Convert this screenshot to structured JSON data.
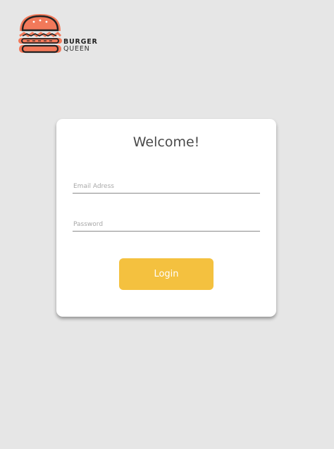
{
  "brand": {
    "line1": "BURGER",
    "line2": "QUEEN",
    "logo_icon": "burger-icon",
    "accent_color": "#f2795a"
  },
  "login": {
    "title": "Welcome!",
    "email_placeholder": "Email Adress",
    "password_placeholder": "Password",
    "button_label": "Login",
    "button_color": "#f4c13f"
  },
  "page_background": "#e6e6e6"
}
